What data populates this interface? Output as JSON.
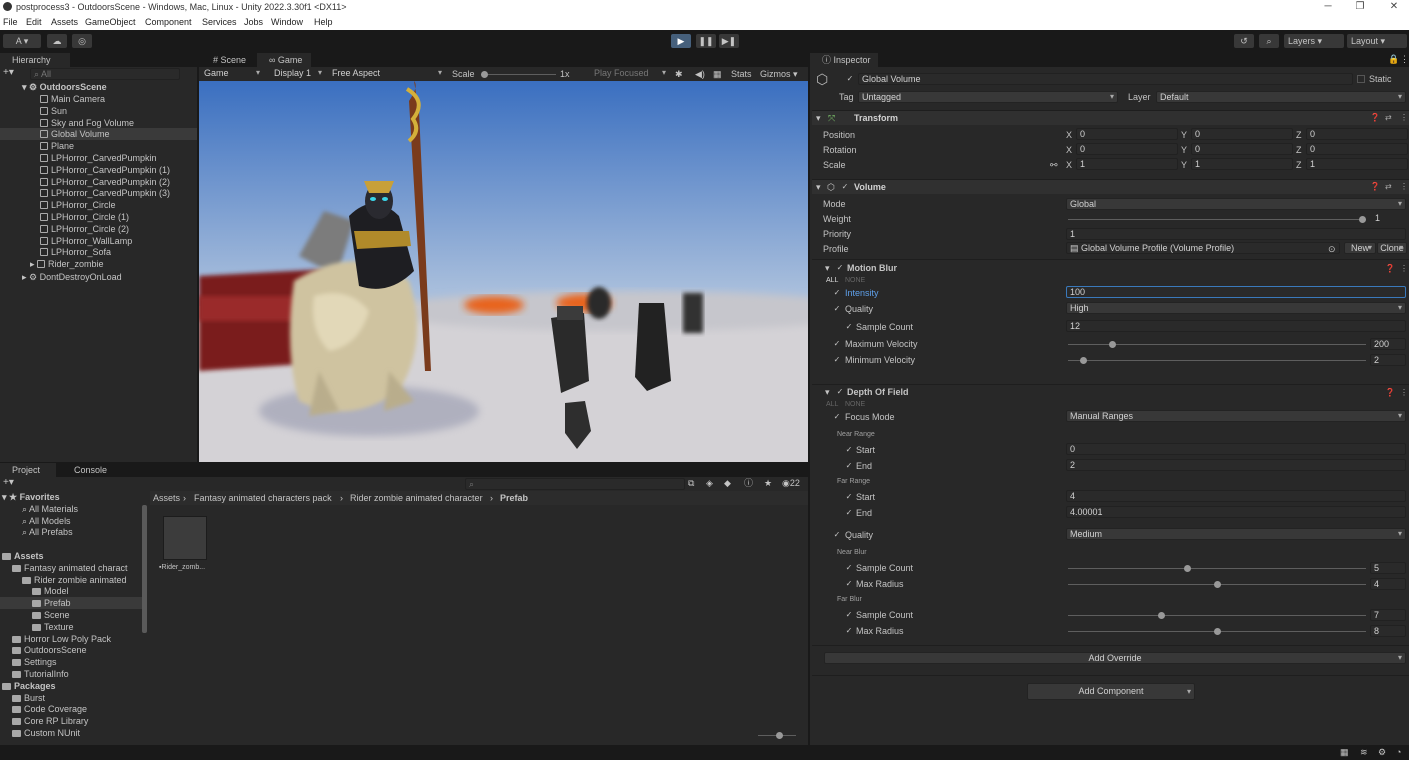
{
  "titlebar": {
    "title": "postprocess3 - OutdoorsScene - Windows, Mac, Linux - Unity 2022.3.30f1 <DX11>",
    "minimize": "─",
    "maximize": "❐",
    "close": "✕"
  },
  "menu": [
    "File",
    "Edit",
    "Assets",
    "GameObject",
    "Component",
    "Services",
    "Jobs",
    "Window",
    "Help"
  ],
  "toolbar": {
    "account": "A ▾",
    "layers": "Layers",
    "layout": "Layout"
  },
  "hierarchy": {
    "tab": "Hierarchy",
    "search_placeholder": "All",
    "scene": "OutdoorsScene",
    "items": [
      "Main Camera",
      "Sun",
      "Sky and Fog Volume",
      "Global Volume",
      "Plane",
      "LPHorror_CarvedPumpkin",
      "LPHorror_CarvedPumpkin (1)",
      "LPHorror_CarvedPumpkin (2)",
      "LPHorror_CarvedPumpkin (3)",
      "LPHorror_Circle",
      "LPHorror_Circle (1)",
      "LPHorror_Circle (2)",
      "LPHorror_WallLamp",
      "LPHorror_Sofa",
      "Rider_zombie"
    ],
    "dontdestroy": "DontDestroyOnLoad"
  },
  "game": {
    "tab_scene": "Scene",
    "tab_game": "Game",
    "mode": "Game",
    "display": "Display 1",
    "aspect": "Free Aspect",
    "scale_label": "Scale",
    "scale_value": "1x",
    "play_focused": "Play Focused",
    "stats": "Stats",
    "gizmos": "Gizmos"
  },
  "project": {
    "tab_project": "Project",
    "tab_console": "Console",
    "count": "22",
    "breadcrumb": [
      "Assets",
      "Fantasy animated characters pack",
      "Rider zombie animated character",
      "Prefab"
    ],
    "asset_name": "Rider_zomb...",
    "tree": [
      {
        "label": "Favorites",
        "indent": 0,
        "type": "star",
        "bold": true
      },
      {
        "label": "All Materials",
        "indent": 2,
        "type": "search"
      },
      {
        "label": "All Models",
        "indent": 2,
        "type": "search"
      },
      {
        "label": "All Prefabs",
        "indent": 2,
        "type": "search"
      },
      {
        "label": "",
        "indent": 0,
        "type": "blank"
      },
      {
        "label": "Assets",
        "indent": 0,
        "type": "folder",
        "bold": true
      },
      {
        "label": "Fantasy animated charact",
        "indent": 1,
        "type": "folder"
      },
      {
        "label": "Rider zombie animated",
        "indent": 2,
        "type": "folder"
      },
      {
        "label": "Model",
        "indent": 3,
        "type": "folder"
      },
      {
        "label": "Prefab",
        "indent": 3,
        "type": "folder",
        "selected": true
      },
      {
        "label": "Scene",
        "indent": 3,
        "type": "folder"
      },
      {
        "label": "Texture",
        "indent": 3,
        "type": "folder"
      },
      {
        "label": "Horror Low Poly Pack",
        "indent": 1,
        "type": "folder"
      },
      {
        "label": "OutdoorsScene",
        "indent": 1,
        "type": "folder"
      },
      {
        "label": "Settings",
        "indent": 1,
        "type": "folder"
      },
      {
        "label": "TutorialInfo",
        "indent": 1,
        "type": "folder"
      },
      {
        "label": "Packages",
        "indent": 0,
        "type": "folder",
        "bold": true
      },
      {
        "label": "Burst",
        "indent": 1,
        "type": "folder"
      },
      {
        "label": "Code Coverage",
        "indent": 1,
        "type": "folder"
      },
      {
        "label": "Core RP Library",
        "indent": 1,
        "type": "folder"
      },
      {
        "label": "Custom NUnit",
        "indent": 1,
        "type": "folder"
      }
    ]
  },
  "inspector": {
    "tab": "Inspector",
    "object_name": "Global Volume",
    "static": "Static",
    "tag_label": "Tag",
    "tag": "Untagged",
    "layer_label": "Layer",
    "layer": "Default",
    "transform": {
      "title": "Transform",
      "position": "Position",
      "rotation": "Rotation",
      "scale": "Scale",
      "pos": [
        "0",
        "0",
        "0"
      ],
      "rot": [
        "0",
        "0",
        "0"
      ],
      "scl": [
        "1",
        "1",
        "1"
      ],
      "x": "X",
      "y": "Y",
      "z": "Z"
    },
    "volume": {
      "title": "Volume",
      "mode_label": "Mode",
      "mode": "Global",
      "weight_label": "Weight",
      "weight": "1",
      "weight_fraction": 1.0,
      "priority_label": "Priority",
      "priority": "1",
      "profile_label": "Profile",
      "profile": "Global Volume Profile (Volume Profile)",
      "new": "New",
      "clone": "Clone"
    },
    "motion_blur": {
      "title": "Motion Blur",
      "all": "ALL",
      "none": "NONE",
      "intensity_label": "Intensity",
      "intensity": "100",
      "quality_label": "Quality",
      "quality": "High",
      "sample_count_label": "Sample Count",
      "sample_count": "12",
      "max_vel_label": "Maximum Velocity",
      "max_vel": "200",
      "max_vel_fraction": 0.14,
      "min_vel_label": "Minimum Velocity",
      "min_vel": "2",
      "min_vel_fraction": 0.04
    },
    "dof": {
      "title": "Depth Of Field",
      "all": "ALL",
      "none": "NONE",
      "focus_mode_label": "Focus Mode",
      "focus_mode": "Manual Ranges",
      "near_range": "Near Range",
      "far_range": "Far Range",
      "start": "Start",
      "end": "End",
      "near_start": "0",
      "near_end": "2",
      "far_start": "4",
      "far_end": "4.00001",
      "quality_label": "Quality",
      "quality": "Medium",
      "near_blur": "Near Blur",
      "far_blur": "Far Blur",
      "sample_count_label": "Sample Count",
      "max_radius_label": "Max Radius",
      "near_sample": "5",
      "near_sample_fraction": 0.4,
      "near_radius": "4",
      "near_radius_fraction": 0.5,
      "far_sample": "7",
      "far_sample_fraction": 0.31,
      "far_radius": "8",
      "far_radius_fraction": 0.5
    },
    "add_override": "Add Override",
    "add_component": "Add Component"
  }
}
